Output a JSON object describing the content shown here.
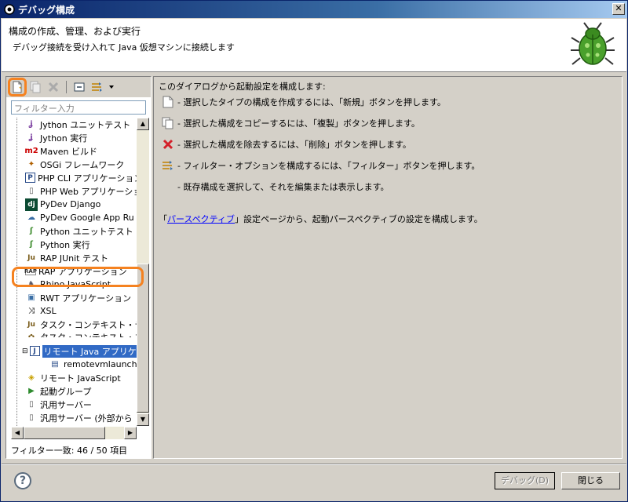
{
  "window": {
    "title": "デバッグ構成"
  },
  "header": {
    "title": "構成の作成、管理、および実行",
    "description": "デバッグ接続を受け入れて Java 仮想マシンに接続します"
  },
  "toolbar": {
    "new": "new-config",
    "duplicate": "duplicate-config",
    "delete": "delete-config",
    "collapse": "collapse-all",
    "filter": "filter"
  },
  "filter": {
    "placeholder": "フィルター入力"
  },
  "tree": {
    "items": [
      {
        "label": "Jython ユニットテスト",
        "icon": "jython-test-icon"
      },
      {
        "label": "Jython 実行",
        "icon": "jython-run-icon"
      },
      {
        "label": "Maven ビルド",
        "icon": "maven-icon"
      },
      {
        "label": "OSGi フレームワーク",
        "icon": "osgi-icon"
      },
      {
        "label": "PHP CLI アプリケーション",
        "icon": "php-cli-icon"
      },
      {
        "label": "PHP Web アプリケーション",
        "icon": "php-web-icon"
      },
      {
        "label": "PyDev Django",
        "icon": "django-icon"
      },
      {
        "label": "PyDev Google App Ru",
        "icon": "google-app-icon"
      },
      {
        "label": "Python ユニットテスト",
        "icon": "python-test-icon"
      },
      {
        "label": "Python 実行",
        "icon": "python-run-icon"
      },
      {
        "label": "RAP JUnit テスト",
        "icon": "rap-junit-icon"
      },
      {
        "label": "RAP アプリケーション",
        "icon": "rap-app-icon"
      },
      {
        "label": "Rhino JavaScript",
        "icon": "rhino-icon"
      },
      {
        "label": "RWT アプリケーション",
        "icon": "rwt-icon"
      },
      {
        "label": "XSL",
        "icon": "xsl-icon"
      },
      {
        "label": "タスク・コンテキスト・テスト",
        "icon": "task-test-icon"
      },
      {
        "label": "タスク・コンテキスト・プラグ",
        "icon": "task-plugin-icon"
      },
      {
        "label": "リモート Java アプリケー",
        "icon": "remote-java-icon",
        "selected": true
      },
      {
        "label": "remotevmlauncher",
        "icon": "launcher-icon",
        "child": true
      },
      {
        "label": "リモート JavaScript",
        "icon": "remote-js-icon"
      },
      {
        "label": "起動グループ",
        "icon": "launch-group-icon"
      },
      {
        "label": "汎用サーバー",
        "icon": "server-icon"
      },
      {
        "label": "汎用サーバー (外部から",
        "icon": "server-ext-icon"
      }
    ]
  },
  "filter_status": "フィルター一致: 46 / 50 項目",
  "right": {
    "intro": "このダイアログから起動設定を構成します:",
    "rows": [
      {
        "icon": "new-icon",
        "text": "- 選択したタイプの構成を作成するには、「新規」ボタンを押します。"
      },
      {
        "icon": "duplicate-icon",
        "text": "- 選択した構成をコピーするには、「複製」ボタンを押します。"
      },
      {
        "icon": "delete-icon",
        "text": "- 選択した構成を除去するには、「削除」ボタンを押します。"
      },
      {
        "icon": "filter-icon",
        "text": "- フィルター・オプションを構成するには、「フィルター」ボタンを押します。"
      },
      {
        "icon": "none",
        "text": "- 既存構成を選択して、それを編集または表示します。"
      }
    ],
    "link_prefix": "「",
    "link_text": "パースペクティブ",
    "link_suffix": "」設定ページから、起動パースペクティブの設定を構成します。"
  },
  "buttons": {
    "debug": "デバッグ(D)",
    "close": "閉じる"
  },
  "colors": {
    "highlight": "#f58220",
    "selection": "#316ac5",
    "link": "#0000ff"
  }
}
